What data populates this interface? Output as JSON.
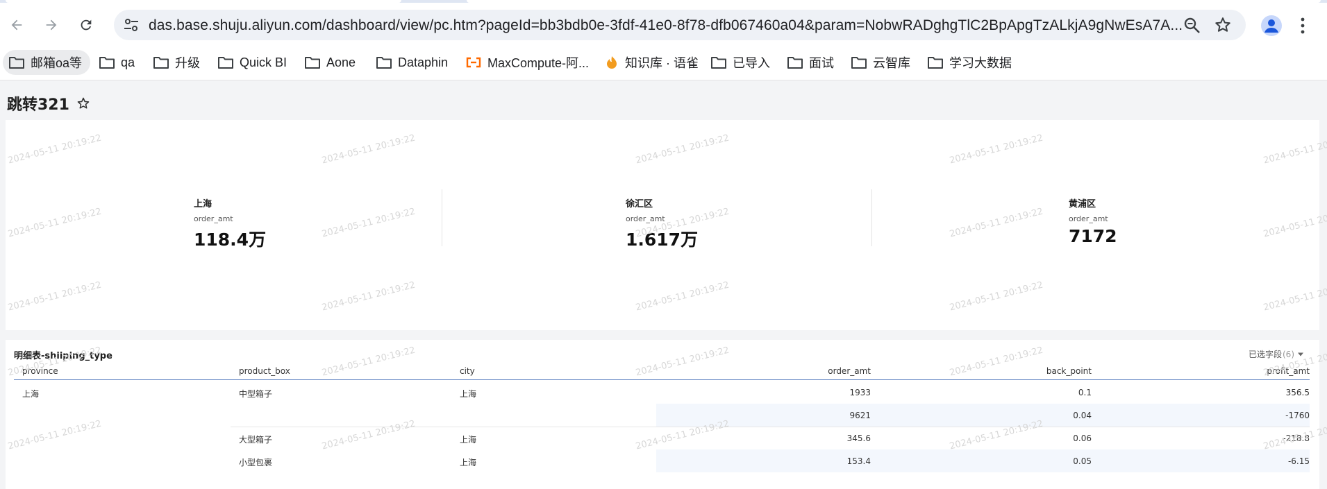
{
  "browser": {
    "url": "das.base.shuju.aliyun.com/dashboard/view/pc.htm?pageId=bb3bdb0e-3fdf-41e0-8f78-dfb067460a04&param=NobwRADghgTlC2BpApgTzALkjA9gNwEsA7A...",
    "bookmarks": [
      {
        "label": "邮箱oa等",
        "icon": "folder-icon"
      },
      {
        "label": "qa",
        "icon": "folder-icon"
      },
      {
        "label": "升级",
        "icon": "folder-icon"
      },
      {
        "label": "Quick BI",
        "icon": "folder-icon"
      },
      {
        "label": "Aone",
        "icon": "folder-icon"
      },
      {
        "label": "Dataphin",
        "icon": "folder-icon"
      },
      {
        "label": "MaxCompute-阿...",
        "icon": "aliyun-icon"
      },
      {
        "label": "知识库 · 语雀",
        "icon": "yuque-icon"
      },
      {
        "label": "已导入",
        "icon": "folder-icon"
      },
      {
        "label": "面试",
        "icon": "folder-icon"
      },
      {
        "label": "云智库",
        "icon": "folder-icon"
      },
      {
        "label": "学习大数据",
        "icon": "folder-icon"
      }
    ]
  },
  "dashboard": {
    "title": "跳转321",
    "watermark": "2024-05-11 20:19:22",
    "kpis": [
      {
        "name": "上海",
        "measure": "order_amt",
        "value": "118.4万"
      },
      {
        "name": "徐汇区",
        "measure": "order_amt",
        "value": "1.617万"
      },
      {
        "name": "黄浦区",
        "measure": "order_amt",
        "value": "7172"
      }
    ],
    "table": {
      "title": "明细表-shiiping_type",
      "fields_label": "已选字段",
      "fields_count": "(6)",
      "columns": [
        "province",
        "product_box",
        "city",
        "order_amt",
        "back_point",
        "profit_amt"
      ],
      "rows": [
        {
          "province": "上海",
          "product_box": "中型箱子",
          "city": "上海",
          "order_amt": "1933",
          "back_point": "0.1",
          "profit_amt": "356.5"
        },
        {
          "province": "",
          "product_box": "",
          "city": "",
          "order_amt": "9621",
          "back_point": "0.04",
          "profit_amt": "-1760"
        },
        {
          "province": "",
          "product_box": "大型箱子",
          "city": "上海",
          "order_amt": "345.6",
          "back_point": "0.06",
          "profit_amt": "-218.8"
        },
        {
          "province": "",
          "product_box": "小型包裹",
          "city": "上海",
          "order_amt": "153.4",
          "back_point": "0.05",
          "profit_amt": "-6.15"
        }
      ]
    }
  },
  "colors": {
    "accent": "#5b7fbf",
    "row_shade": "#f3f7fd"
  }
}
